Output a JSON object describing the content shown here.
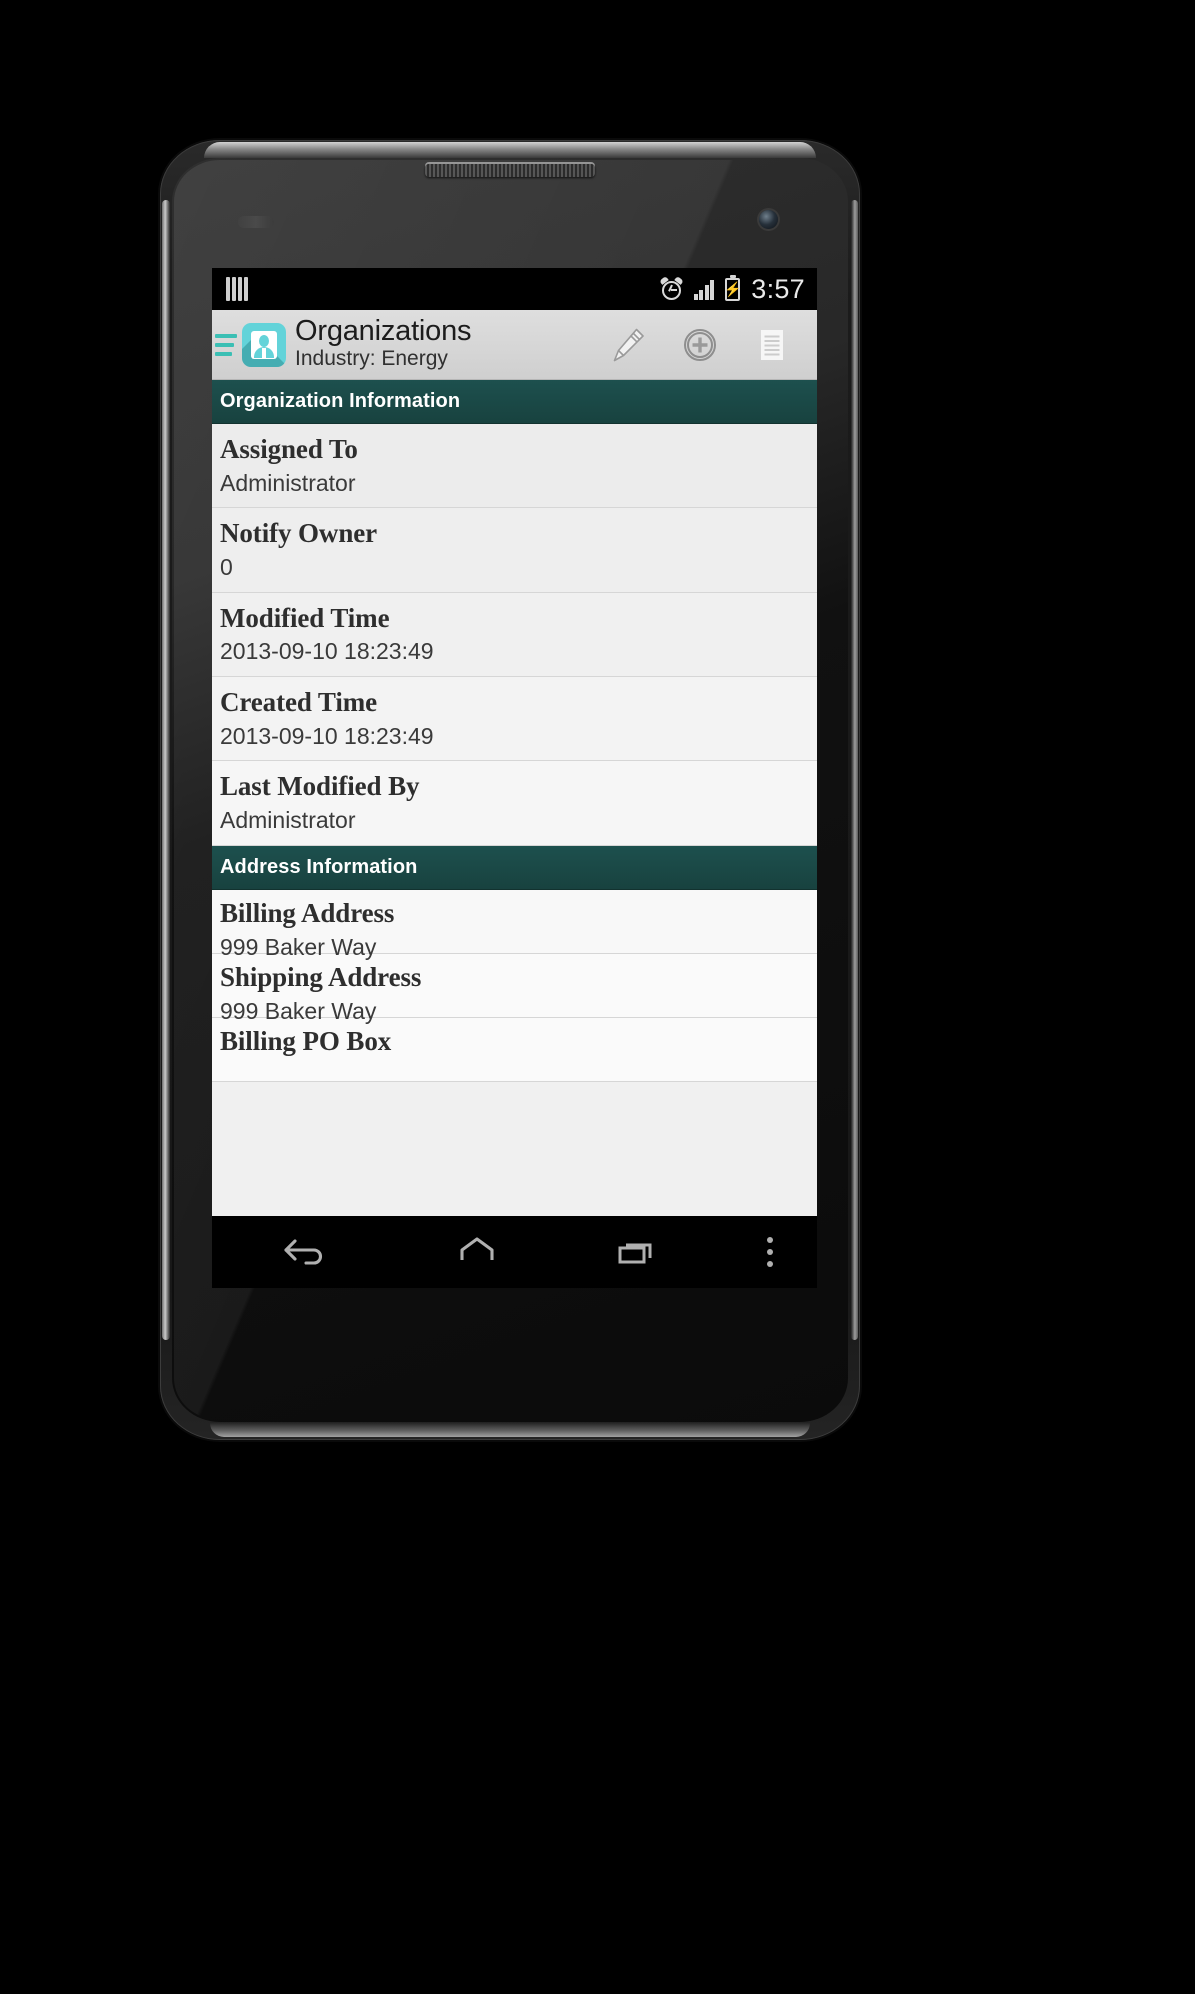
{
  "status_bar": {
    "sim_icon": "sim-card-icon",
    "alarm_icon": "alarm-clock-icon",
    "signal_icon": "signal-bars-icon",
    "battery_icon": "battery-charging-icon",
    "time": "3:57"
  },
  "action_bar": {
    "menu_icon": "hamburger-menu-icon",
    "app_icon": "organizations-app-icon",
    "title": "Organizations",
    "subtitle": "Industry: Energy",
    "actions": [
      {
        "name": "edit-button",
        "icon": "pencil-icon"
      },
      {
        "name": "add-button",
        "icon": "circle-plus-icon"
      },
      {
        "name": "related-list-button",
        "icon": "document-lines-icon"
      }
    ]
  },
  "sections": [
    {
      "title": "Organization Information",
      "fields": [
        {
          "label": "Assigned To",
          "value": "Administrator"
        },
        {
          "label": "Notify Owner",
          "value": "0"
        },
        {
          "label": "Modified Time",
          "value": "2013-09-10 18:23:49"
        },
        {
          "label": "Created Time",
          "value": "2013-09-10 18:23:49"
        },
        {
          "label": "Last Modified By",
          "value": "Administrator"
        }
      ]
    },
    {
      "title": "Address Information",
      "fields": [
        {
          "label": "Billing Address",
          "value": "999 Baker Way"
        },
        {
          "label": "Shipping Address",
          "value": "999 Baker Way"
        },
        {
          "label": "Billing PO Box",
          "value": ""
        }
      ]
    }
  ],
  "nav_bar": {
    "back_icon": "back-arrow-icon",
    "home_icon": "home-icon",
    "recents_icon": "recent-apps-icon",
    "menu_icon": "overflow-menu-icon"
  },
  "colors": {
    "accent_teal": "#63d3d9",
    "section_teal": "#1d504e",
    "action_bar": "#d9d9d9",
    "background": "#f0f0f0"
  }
}
